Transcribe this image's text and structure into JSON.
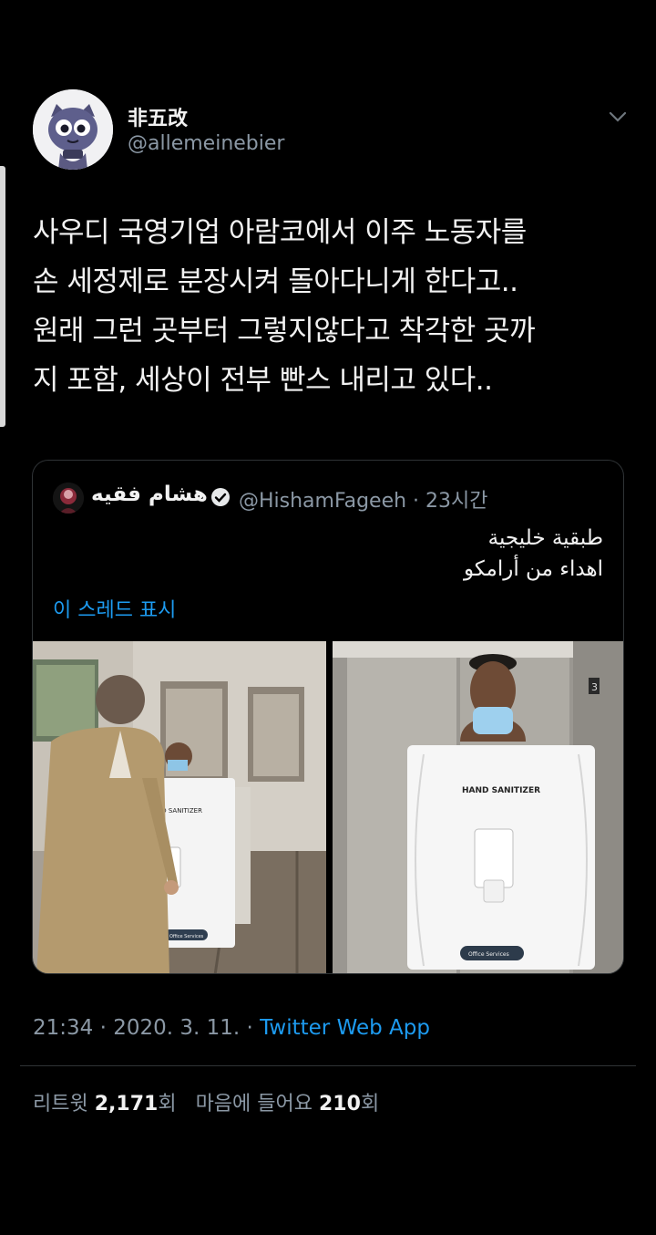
{
  "tweet": {
    "display_name": "非五改",
    "username": "@allemeinebier",
    "text_lines": [
      "사우디 국영기업 아람코에서 이주 노동자를",
      "손 세정제로 분장시켜 돌아다니게 한다고..",
      "원래 그런 곳부터 그렇지않다고 착각한 곳까",
      "지 포함, 세상이 전부 빤스 내리고 있다.."
    ],
    "icons": {
      "menu": "chevron-down-icon",
      "verified": "verified-badge-icon"
    }
  },
  "quote": {
    "display_name": "هشام فقيه",
    "handle_time": "@HishamFageeh · 23시간",
    "text_lines": [
      "طبقية خليجية",
      "اهداء من أرامكو"
    ],
    "thread_link": "이 스레드 표시",
    "photo_left": {
      "sign_text": "ND SANITIZER",
      "badge_text": "Office Services"
    },
    "photo_right": {
      "sign_text": "HAND SANITIZER",
      "badge_text": "Office Services",
      "floor": "3"
    }
  },
  "meta": {
    "time": "21:34",
    "date": "2020. 3. 11.",
    "sep": " · ",
    "source": "Twitter Web App"
  },
  "stats": {
    "retweets_label": "리트윗",
    "retweets_count": "2,171",
    "retweets_suffix": "회",
    "likes_label": "마음에 들어요",
    "likes_count": "210",
    "likes_suffix": "회"
  },
  "colors": {
    "background": "#000000",
    "link": "#1d9bf0",
    "muted": "#8b98a5"
  }
}
